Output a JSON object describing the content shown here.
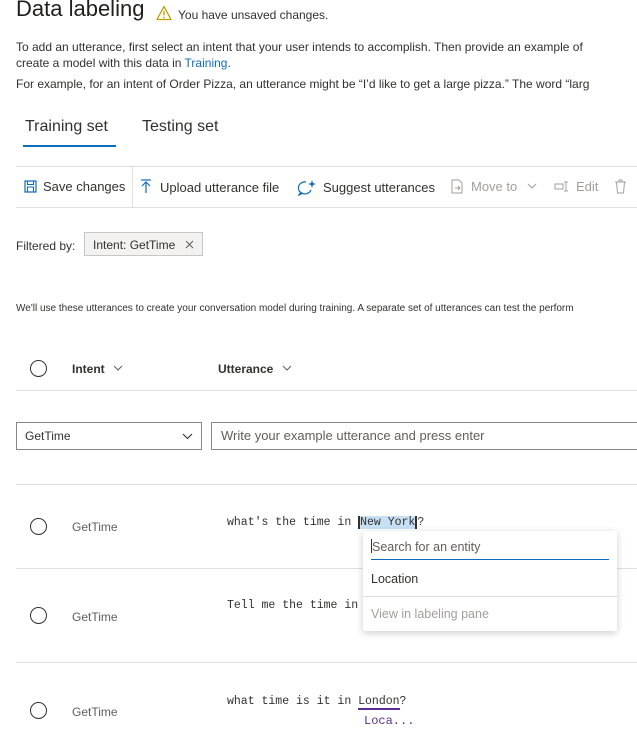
{
  "header": {
    "title": "Data labeling",
    "unsaved": "You have unsaved changes."
  },
  "description": {
    "line1": "To add an utterance, first select an intent that your user intends to accomplish. Then provide an example of",
    "line2_prefix": "create a model with this data in ",
    "line2_link": "Training",
    "line2_suffix": ".",
    "line3": "For example, for an intent of Order Pizza, an utterance might be “I’d like to get a large pizza.” The word “larg"
  },
  "tabs": [
    "Training set",
    "Testing set"
  ],
  "toolbar": {
    "save": "Save changes",
    "upload": "Upload utterance file",
    "suggest": "Suggest utterances",
    "move": "Move to",
    "edit": "Edit"
  },
  "filter": {
    "label": "Filtered by:",
    "pill": "Intent: GetTime"
  },
  "info_text": "We'll use these utterances to create your conversation model during training. A separate set of utterances can test the perform",
  "columns": {
    "intent": "Intent",
    "utterance": "Utterance"
  },
  "new_row": {
    "intent_value": "GetTime",
    "placeholder": "Write your example utterance and press enter"
  },
  "rows": [
    {
      "intent": "GetTime",
      "utterance_pre": "what's the time in ",
      "utterance_entity": "New York",
      "utterance_post": "?"
    },
    {
      "intent": "GetTime",
      "utterance_pre": "Tell me the time in",
      "utterance_entity": "",
      "utterance_post": ""
    },
    {
      "intent": "GetTime",
      "utterance_pre": "what time is it in ",
      "utterance_entity": "London",
      "utterance_post": "?",
      "entity_label": "Loca..."
    }
  ],
  "entity_popup": {
    "search_placeholder": "Search for an entity",
    "option": "Location",
    "footer": "View in labeling pane"
  },
  "colors": {
    "accent": "#0f6cbd",
    "entity_highlight": "#c7e0f4",
    "entity_label": "#5c2e91",
    "warning": "#c19c00"
  }
}
